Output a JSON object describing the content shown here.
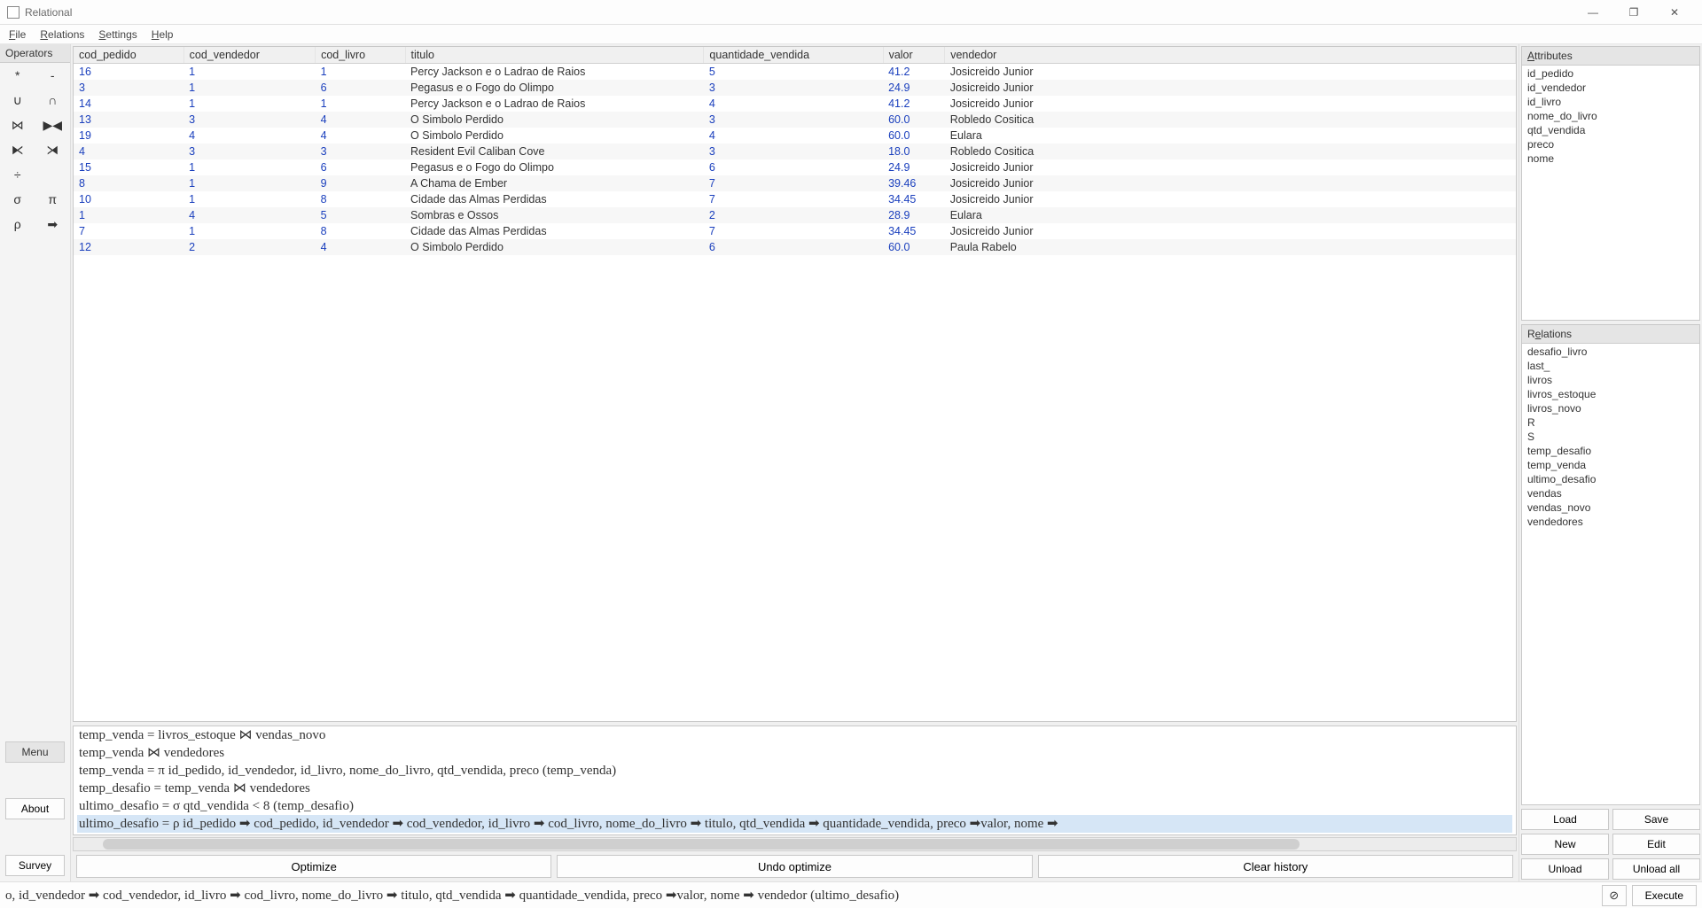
{
  "window": {
    "title": "Relational"
  },
  "menu": {
    "file": "File",
    "relations": "Relations",
    "settings": "Settings",
    "help": "Help"
  },
  "operators": {
    "header": "Operators",
    "grid": [
      [
        "*",
        "-"
      ],
      [
        "∪",
        "∩"
      ],
      [
        "⋈",
        "▶◀"
      ],
      [
        "⧔",
        "⧕"
      ],
      [
        "÷",
        ""
      ],
      [
        "σ",
        "π"
      ],
      [
        "ρ",
        "➡"
      ]
    ],
    "menu_label": "Menu",
    "about_label": "About",
    "survey_label": "Survey"
  },
  "table": {
    "headers": [
      "cod_pedido",
      "cod_vendedor",
      "cod_livro",
      "titulo",
      "quantidade_vendida",
      "valor",
      "vendedor"
    ],
    "rows": [
      [
        "16",
        "1",
        "1",
        "Percy Jackson e o Ladrao de Raios",
        "5",
        "41.2",
        "Josicreido Junior"
      ],
      [
        "3",
        "1",
        "6",
        "Pegasus e o Fogo do Olimpo",
        "3",
        "24.9",
        "Josicreido Junior"
      ],
      [
        "14",
        "1",
        "1",
        "Percy Jackson e o Ladrao de Raios",
        "4",
        "41.2",
        "Josicreido Junior"
      ],
      [
        "13",
        "3",
        "4",
        "O Simbolo Perdido",
        "3",
        "60.0",
        "Robledo Cositica"
      ],
      [
        "19",
        "4",
        "4",
        "O Simbolo Perdido",
        "4",
        "60.0",
        "Eulara"
      ],
      [
        "4",
        "3",
        "3",
        "Resident Evil Caliban Cove",
        "3",
        "18.0",
        "Robledo Cositica"
      ],
      [
        "15",
        "1",
        "6",
        "Pegasus e o Fogo do Olimpo",
        "6",
        "24.9",
        "Josicreido Junior"
      ],
      [
        "8",
        "1",
        "9",
        "A Chama de Ember",
        "7",
        "39.46",
        "Josicreido Junior"
      ],
      [
        "10",
        "1",
        "8",
        "Cidade das Almas Perdidas",
        "7",
        "34.45",
        "Josicreido Junior"
      ],
      [
        "1",
        "4",
        "5",
        "Sombras e Ossos",
        "2",
        "28.9",
        "Eulara"
      ],
      [
        "7",
        "1",
        "8",
        "Cidade das Almas Perdidas",
        "7",
        "34.45",
        "Josicreido Junior"
      ],
      [
        "12",
        "2",
        "4",
        "O Simbolo Perdido",
        "6",
        "60.0",
        "Paula Rabelo"
      ]
    ],
    "numeric_cols": [
      0,
      1,
      2,
      4,
      5
    ]
  },
  "history": {
    "lines": [
      "temp_venda = livros_estoque ⋈ vendas_novo",
      "temp_venda ⋈ vendedores",
      "temp_venda = π id_pedido, id_vendedor, id_livro, nome_do_livro, qtd_vendida, preco (temp_venda)",
      "temp_desafio = temp_venda ⋈ vendedores",
      "ultimo_desafio = σ qtd_vendida < 8 (temp_desafio)",
      "ultimo_desafio = ρ id_pedido ➡ cod_pedido, id_vendedor ➡ cod_vendedor, id_livro ➡ cod_livro, nome_do_livro ➡ titulo, qtd_vendida ➡ quantidade_vendida, preco ➡valor, nome ➡"
    ],
    "selected_index": 5
  },
  "center_buttons": {
    "optimize": "Optimize",
    "undo": "Undo optimize",
    "clear": "Clear history"
  },
  "attributes": {
    "header": "Attributes",
    "items": [
      "id_pedido",
      "id_vendedor",
      "id_livro",
      "nome_do_livro",
      "qtd_vendida",
      "preco",
      "nome"
    ]
  },
  "relations": {
    "header": "Relations",
    "items": [
      "desafio_livro",
      "last_",
      "livros",
      "livros_estoque",
      "livros_novo",
      "R",
      "S",
      "temp_desafio",
      "temp_venda",
      "ultimo_desafio",
      "vendas",
      "vendas_novo",
      "vendedores"
    ]
  },
  "right_buttons": {
    "load": "Load",
    "save": "Save",
    "new": "New",
    "edit": "Edit",
    "unload": "Unload",
    "unload_all": "Unload all"
  },
  "querybar": {
    "text": "o, id_vendedor ➡ cod_vendedor, id_livro ➡ cod_livro, nome_do_livro ➡ titulo, qtd_vendida ➡ quantidade_vendida, preco ➡valor, nome ➡ vendedor (ultimo_desafio)",
    "clear_icon": "⊘",
    "execute": "Execute"
  }
}
